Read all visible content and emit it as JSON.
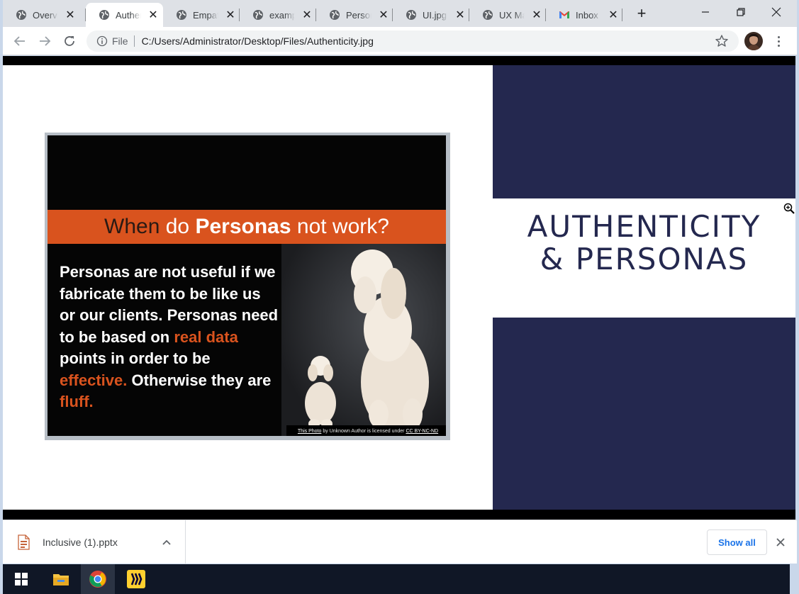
{
  "browser": {
    "tabs": [
      {
        "title": "Overview",
        "active": false
      },
      {
        "title": "Authenticity",
        "active": true
      },
      {
        "title": "Empathy",
        "active": false
      },
      {
        "title": "example",
        "active": false
      },
      {
        "title": "Personas",
        "active": false
      },
      {
        "title": "UI.jpg",
        "active": false
      },
      {
        "title": "UX Ma",
        "active": false
      },
      {
        "title": "Inbox",
        "active": false,
        "icon": "gmail-icon"
      }
    ],
    "new_tab": "+",
    "omnibox": {
      "chip": "File",
      "url": "C:/Users/Administrator/Desktop/Files/Authenticity.jpg"
    }
  },
  "slide": {
    "title_line1": "AUTHENTICITY",
    "title_line2": "& PERSONAS",
    "colors": {
      "navy": "#24284f",
      "orange": "#d9531e"
    },
    "picture": {
      "banner_when": "When",
      "banner_do": "do",
      "banner_personas": "Personas",
      "banner_rest": "not work?",
      "body_1": "Personas are not useful if we fabricate them to be like us or our clients. Personas need to be based on ",
      "body_red_1": "real data",
      "body_2": " points in order to be ",
      "body_red_2": "effective.",
      "body_3": " Otherwise they are ",
      "body_red_3": "fluff.",
      "credit_link1": "This Photo",
      "credit_mid": " by Unknown Author is licensed under ",
      "credit_link2": "CC BY-NC-ND"
    }
  },
  "downloads": {
    "file_name": "Inclusive (1).pptx",
    "show_all": "Show all"
  },
  "taskbar": {
    "items": [
      "windows-start",
      "file-explorer",
      "chrome",
      "miro"
    ]
  }
}
